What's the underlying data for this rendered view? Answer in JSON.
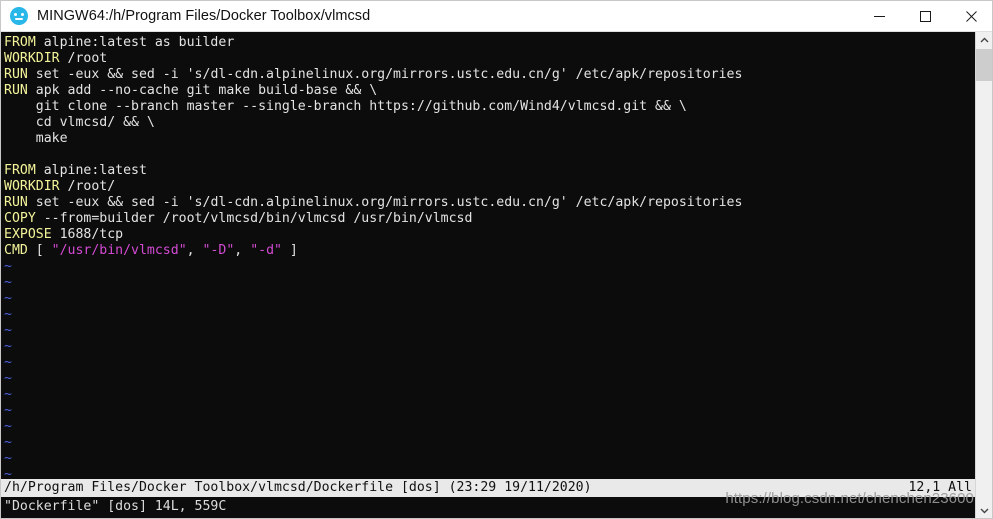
{
  "window": {
    "title": "MINGW64:/h/Program Files/Docker Toolbox/vlmcsd",
    "app_icon": "mintty-icon",
    "controls": {
      "minimize": "minimize-icon",
      "maximize": "maximize-icon",
      "close": "close-icon"
    }
  },
  "editor": {
    "name": "vim",
    "lines": [
      {
        "segments": [
          {
            "t": "FROM",
            "c": "kw"
          },
          {
            "t": " alpine:latest as builder",
            "c": "plain"
          }
        ]
      },
      {
        "segments": [
          {
            "t": "WORKDIR",
            "c": "kw"
          },
          {
            "t": " /root",
            "c": "plain"
          }
        ]
      },
      {
        "segments": [
          {
            "t": "RUN",
            "c": "kw"
          },
          {
            "t": " set -eux && sed -i 's/dl-cdn.alpinelinux.org/mirrors.ustc.edu.cn/g' /etc/apk/repositories",
            "c": "plain"
          }
        ]
      },
      {
        "segments": [
          {
            "t": "RUN",
            "c": "kw"
          },
          {
            "t": " apk add --no-cache git make build-base && \\",
            "c": "plain"
          }
        ]
      },
      {
        "segments": [
          {
            "t": "    git clone --branch master --single-branch https://github.com/Wind4/vlmcsd.git && \\",
            "c": "plain"
          }
        ]
      },
      {
        "segments": [
          {
            "t": "    cd vlmcsd/ && \\",
            "c": "plain"
          }
        ]
      },
      {
        "segments": [
          {
            "t": "    make",
            "c": "plain"
          }
        ]
      },
      {
        "segments": [
          {
            "t": "",
            "c": "plain"
          }
        ]
      },
      {
        "segments": [
          {
            "t": "FROM",
            "c": "kw"
          },
          {
            "t": " alpine:latest",
            "c": "plain"
          }
        ]
      },
      {
        "segments": [
          {
            "t": "WORKDIR",
            "c": "kw"
          },
          {
            "t": " /root/",
            "c": "plain"
          }
        ]
      },
      {
        "segments": [
          {
            "t": "RUN",
            "c": "kw"
          },
          {
            "t": " set -eux && sed -i 's/dl-cdn.alpinelinux.org/mirrors.ustc.edu.cn/g' /etc/apk/repositories",
            "c": "plain"
          }
        ]
      },
      {
        "segments": [
          {
            "t": "COPY",
            "c": "kw"
          },
          {
            "t": " --from=builder /root/vlmcsd/bin/vlmcsd /usr/bin/vlmcsd",
            "c": "plain"
          }
        ]
      },
      {
        "segments": [
          {
            "t": "EXPOSE",
            "c": "kw"
          },
          {
            "t": " 1688/tcp",
            "c": "plain"
          }
        ]
      },
      {
        "segments": [
          {
            "t": "CMD",
            "c": "kw"
          },
          {
            "t": " [ ",
            "c": "plain"
          },
          {
            "t": "\"/usr/bin/vlmcsd\"",
            "c": "str"
          },
          {
            "t": ", ",
            "c": "plain"
          },
          {
            "t": "\"-D\"",
            "c": "str"
          },
          {
            "t": ", ",
            "c": "plain"
          },
          {
            "t": "\"-d\"",
            "c": "str"
          },
          {
            "t": " ]",
            "c": "plain"
          }
        ]
      }
    ],
    "empty_marker": "~",
    "empty_marker_count": 14,
    "status_left": "/h/Program Files/Docker Toolbox/vlmcsd/Dockerfile [dos] (23:29 19/11/2020)",
    "status_right": "12,1 All",
    "message": "\"Dockerfile\" [dos] 14L, 559C"
  },
  "scrollbar": {
    "up_arrow": "chevron-up-icon",
    "down_arrow": "chevron-down-icon"
  },
  "watermark": {
    "text": "https://blog.csdn.net/chenchen23600"
  },
  "colors": {
    "terminal_bg": "#0c0c0c",
    "keyword": "#f3f39a",
    "string": "#d34ad3",
    "text": "#e3e3e3",
    "tilde": "#4a5fe8",
    "status_bg": "#e9e9e9",
    "accent": "#29b6e8"
  }
}
